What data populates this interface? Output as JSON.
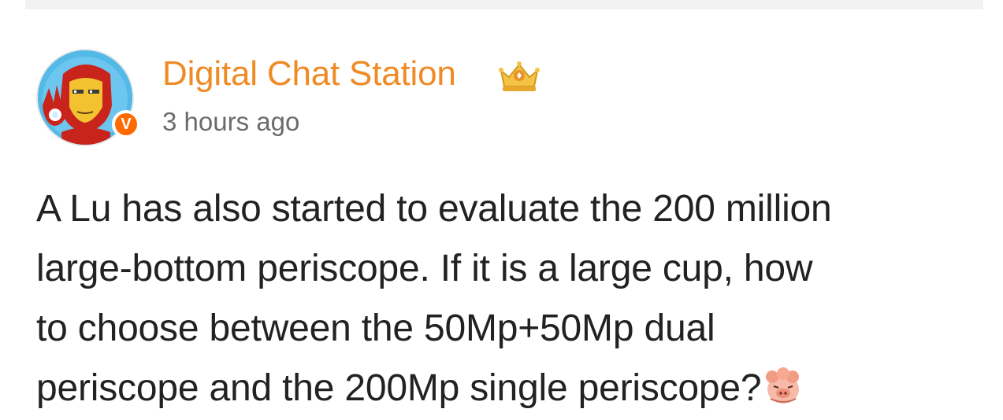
{
  "post": {
    "author": "Digital Chat Station",
    "timestamp": "3 hours ago",
    "author_badge_letter": "V",
    "text_lines": [
      "A Lu has also started to evaluate the 200 million",
      "large-bottom periscope. If it is a large cup, how",
      "to choose between the 50Mp+50Mp dual",
      "periscope and the 200Mp single periscope?"
    ]
  },
  "icons": {
    "avatar": "ironman-avatar",
    "verified": "verified-badge-icon",
    "rank": "crown-rank-icon",
    "emoji": "pig-emoji-icon"
  },
  "colors": {
    "author_name": "#f08a24",
    "timestamp": "#6b6b6b",
    "body_text": "#222222",
    "badge": "#ff6a00"
  }
}
